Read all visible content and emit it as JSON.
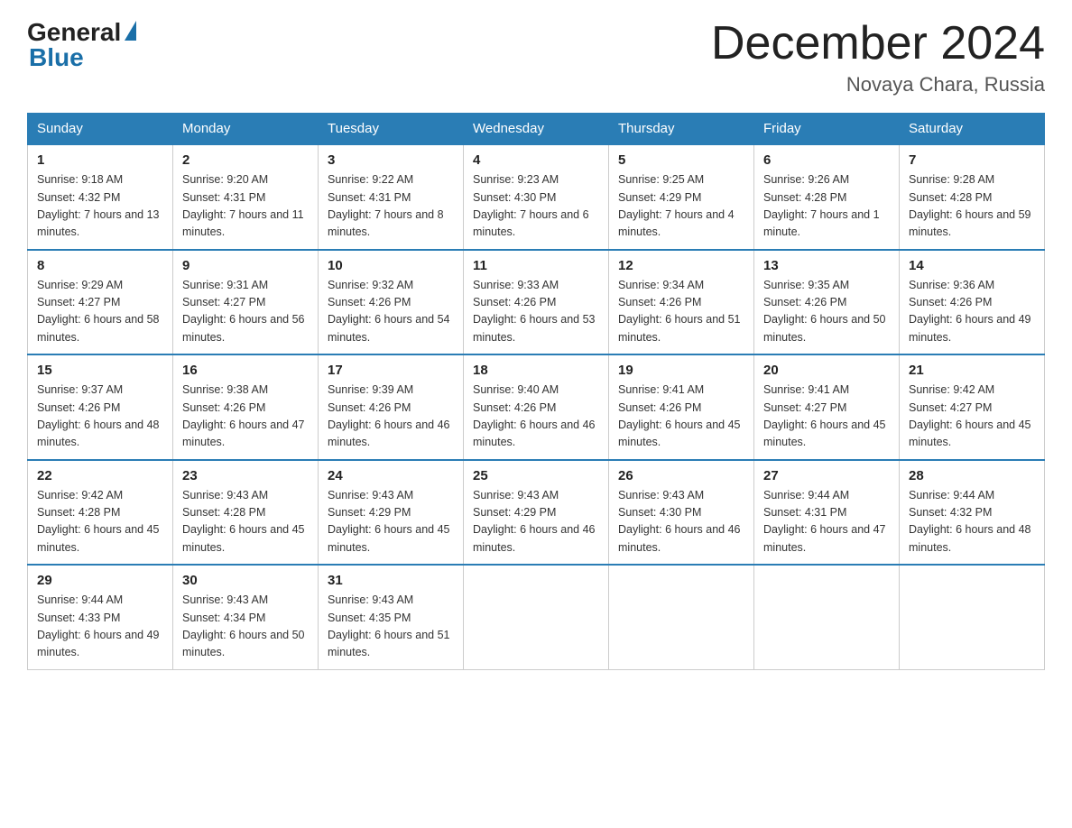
{
  "logo": {
    "general": "General",
    "blue": "Blue"
  },
  "title": "December 2024",
  "location": "Novaya Chara, Russia",
  "days_of_week": [
    "Sunday",
    "Monday",
    "Tuesday",
    "Wednesday",
    "Thursday",
    "Friday",
    "Saturday"
  ],
  "weeks": [
    [
      {
        "num": "1",
        "sunrise": "9:18 AM",
        "sunset": "4:32 PM",
        "daylight": "7 hours and 13 minutes."
      },
      {
        "num": "2",
        "sunrise": "9:20 AM",
        "sunset": "4:31 PM",
        "daylight": "7 hours and 11 minutes."
      },
      {
        "num": "3",
        "sunrise": "9:22 AM",
        "sunset": "4:31 PM",
        "daylight": "7 hours and 8 minutes."
      },
      {
        "num": "4",
        "sunrise": "9:23 AM",
        "sunset": "4:30 PM",
        "daylight": "7 hours and 6 minutes."
      },
      {
        "num": "5",
        "sunrise": "9:25 AM",
        "sunset": "4:29 PM",
        "daylight": "7 hours and 4 minutes."
      },
      {
        "num": "6",
        "sunrise": "9:26 AM",
        "sunset": "4:28 PM",
        "daylight": "7 hours and 1 minute."
      },
      {
        "num": "7",
        "sunrise": "9:28 AM",
        "sunset": "4:28 PM",
        "daylight": "6 hours and 59 minutes."
      }
    ],
    [
      {
        "num": "8",
        "sunrise": "9:29 AM",
        "sunset": "4:27 PM",
        "daylight": "6 hours and 58 minutes."
      },
      {
        "num": "9",
        "sunrise": "9:31 AM",
        "sunset": "4:27 PM",
        "daylight": "6 hours and 56 minutes."
      },
      {
        "num": "10",
        "sunrise": "9:32 AM",
        "sunset": "4:26 PM",
        "daylight": "6 hours and 54 minutes."
      },
      {
        "num": "11",
        "sunrise": "9:33 AM",
        "sunset": "4:26 PM",
        "daylight": "6 hours and 53 minutes."
      },
      {
        "num": "12",
        "sunrise": "9:34 AM",
        "sunset": "4:26 PM",
        "daylight": "6 hours and 51 minutes."
      },
      {
        "num": "13",
        "sunrise": "9:35 AM",
        "sunset": "4:26 PM",
        "daylight": "6 hours and 50 minutes."
      },
      {
        "num": "14",
        "sunrise": "9:36 AM",
        "sunset": "4:26 PM",
        "daylight": "6 hours and 49 minutes."
      }
    ],
    [
      {
        "num": "15",
        "sunrise": "9:37 AM",
        "sunset": "4:26 PM",
        "daylight": "6 hours and 48 minutes."
      },
      {
        "num": "16",
        "sunrise": "9:38 AM",
        "sunset": "4:26 PM",
        "daylight": "6 hours and 47 minutes."
      },
      {
        "num": "17",
        "sunrise": "9:39 AM",
        "sunset": "4:26 PM",
        "daylight": "6 hours and 46 minutes."
      },
      {
        "num": "18",
        "sunrise": "9:40 AM",
        "sunset": "4:26 PM",
        "daylight": "6 hours and 46 minutes."
      },
      {
        "num": "19",
        "sunrise": "9:41 AM",
        "sunset": "4:26 PM",
        "daylight": "6 hours and 45 minutes."
      },
      {
        "num": "20",
        "sunrise": "9:41 AM",
        "sunset": "4:27 PM",
        "daylight": "6 hours and 45 minutes."
      },
      {
        "num": "21",
        "sunrise": "9:42 AM",
        "sunset": "4:27 PM",
        "daylight": "6 hours and 45 minutes."
      }
    ],
    [
      {
        "num": "22",
        "sunrise": "9:42 AM",
        "sunset": "4:28 PM",
        "daylight": "6 hours and 45 minutes."
      },
      {
        "num": "23",
        "sunrise": "9:43 AM",
        "sunset": "4:28 PM",
        "daylight": "6 hours and 45 minutes."
      },
      {
        "num": "24",
        "sunrise": "9:43 AM",
        "sunset": "4:29 PM",
        "daylight": "6 hours and 45 minutes."
      },
      {
        "num": "25",
        "sunrise": "9:43 AM",
        "sunset": "4:29 PM",
        "daylight": "6 hours and 46 minutes."
      },
      {
        "num": "26",
        "sunrise": "9:43 AM",
        "sunset": "4:30 PM",
        "daylight": "6 hours and 46 minutes."
      },
      {
        "num": "27",
        "sunrise": "9:44 AM",
        "sunset": "4:31 PM",
        "daylight": "6 hours and 47 minutes."
      },
      {
        "num": "28",
        "sunrise": "9:44 AM",
        "sunset": "4:32 PM",
        "daylight": "6 hours and 48 minutes."
      }
    ],
    [
      {
        "num": "29",
        "sunrise": "9:44 AM",
        "sunset": "4:33 PM",
        "daylight": "6 hours and 49 minutes."
      },
      {
        "num": "30",
        "sunrise": "9:43 AM",
        "sunset": "4:34 PM",
        "daylight": "6 hours and 50 minutes."
      },
      {
        "num": "31",
        "sunrise": "9:43 AM",
        "sunset": "4:35 PM",
        "daylight": "6 hours and 51 minutes."
      },
      null,
      null,
      null,
      null
    ]
  ]
}
